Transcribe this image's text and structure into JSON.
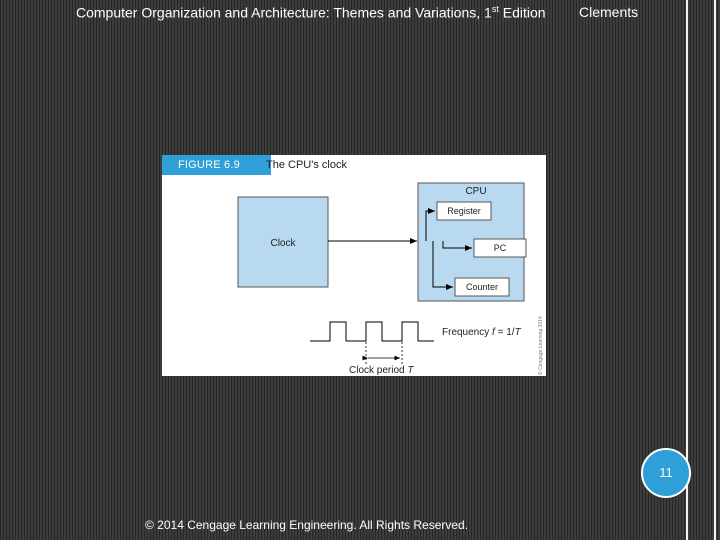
{
  "header": {
    "title_main": "Computer Organization and Architecture: Themes and Variations, 1",
    "title_sup": "st",
    "title_end": " Edition",
    "author": "Clements"
  },
  "figure": {
    "label": "FIGURE 6.9",
    "caption": "The CPU's clock",
    "clock_label": "Clock",
    "cpu_label": "CPU",
    "register_label": "Register",
    "pc_label": "PC",
    "counter_label": "Counter",
    "frequency_prefix": "Frequency ",
    "frequency_var": "f",
    "frequency_suffix": " = 1/",
    "frequency_t": "T",
    "period_prefix": "Clock period ",
    "period_var": "T",
    "copyright_side": "© Cengage Learning 2014"
  },
  "page_number": "11",
  "footer": {
    "copyright": "© 2014 Cengage Learning Engineering. All Rights Reserved."
  },
  "colors": {
    "accent": "#2f9fd8",
    "box_fill": "#b9d9f0"
  }
}
